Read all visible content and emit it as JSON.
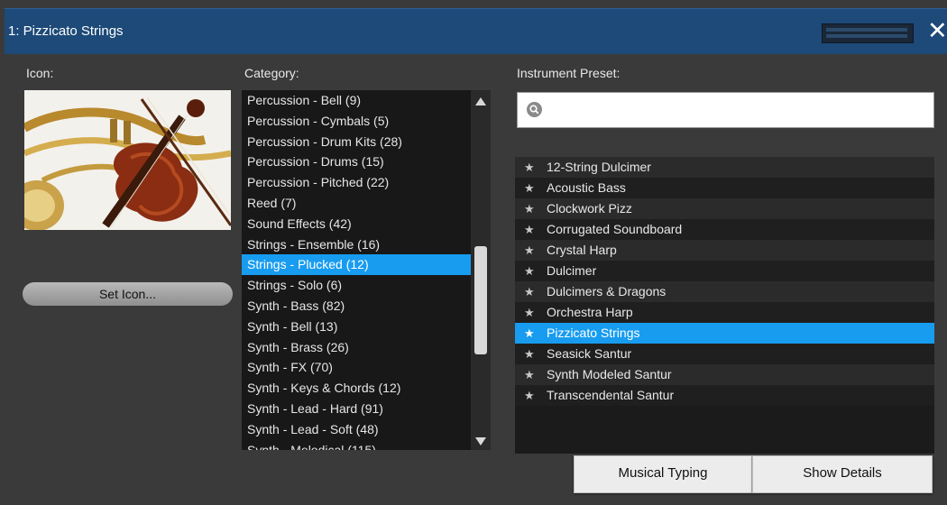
{
  "window": {
    "title": "1: Pizzicato Strings"
  },
  "labels": {
    "icon": "Icon:",
    "category": "Category:",
    "preset": "Instrument Preset:"
  },
  "buttons": {
    "set_icon": "Set Icon...",
    "musical_typing": "Musical Typing",
    "show_details": "Show Details"
  },
  "search": {
    "placeholder": ""
  },
  "categories": [
    {
      "label": "Percussion - Bell (9)"
    },
    {
      "label": "Percussion - Cymbals (5)"
    },
    {
      "label": "Percussion - Drum Kits (28)"
    },
    {
      "label": "Percussion - Drums (15)"
    },
    {
      "label": "Percussion - Pitched (22)"
    },
    {
      "label": "Reed (7)"
    },
    {
      "label": "Sound Effects (42)"
    },
    {
      "label": "Strings - Ensemble (16)"
    },
    {
      "label": "Strings - Plucked (12)",
      "selected": true
    },
    {
      "label": "Strings - Solo (6)"
    },
    {
      "label": "Synth - Bass (82)"
    },
    {
      "label": "Synth - Bell (13)"
    },
    {
      "label": "Synth - Brass (26)"
    },
    {
      "label": "Synth - FX (70)"
    },
    {
      "label": "Synth - Keys & Chords (12)"
    },
    {
      "label": "Synth - Lead - Hard (91)"
    },
    {
      "label": "Synth - Lead - Soft (48)"
    },
    {
      "label": "Synth - Melodical (115)"
    }
  ],
  "presets": [
    {
      "label": "12-String Dulcimer"
    },
    {
      "label": "Acoustic Bass"
    },
    {
      "label": "Clockwork Pizz"
    },
    {
      "label": "Corrugated Soundboard"
    },
    {
      "label": "Crystal Harp"
    },
    {
      "label": "Dulcimer"
    },
    {
      "label": "Dulcimers & Dragons"
    },
    {
      "label": "Orchestra Harp"
    },
    {
      "label": "Pizzicato Strings",
      "selected": true
    },
    {
      "label": "Seasick Santur"
    },
    {
      "label": "Synth Modeled Santur"
    },
    {
      "label": "Transcendental Santur"
    }
  ],
  "colors": {
    "titlebar": "#1d4a78",
    "selection": "#189cf0",
    "background": "#3a3a3a"
  }
}
